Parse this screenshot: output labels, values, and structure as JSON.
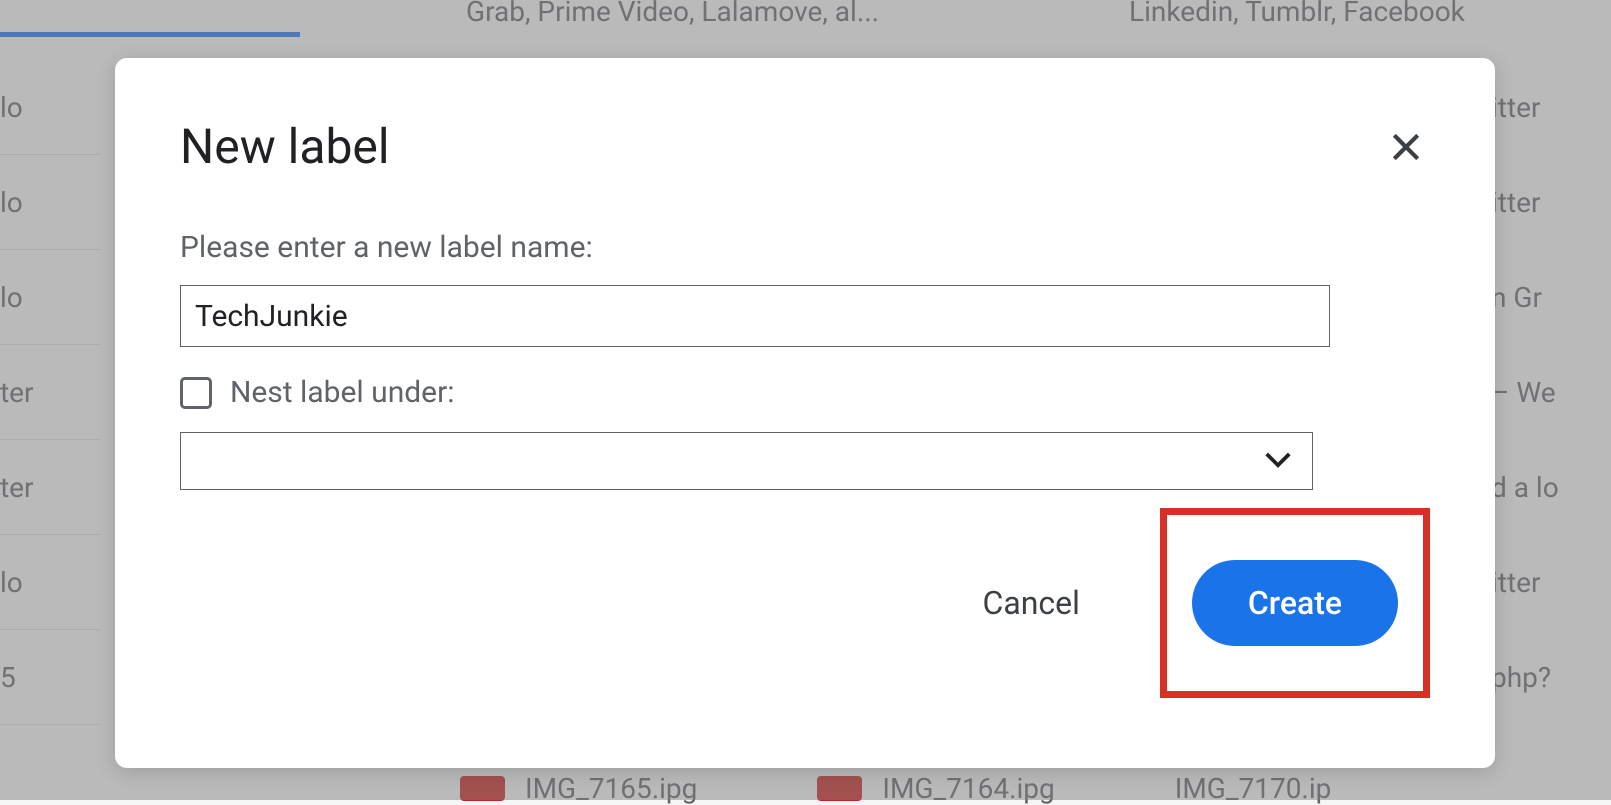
{
  "background": {
    "top_text_1": "Grab, Prime Video, Lalamove, al...",
    "top_text_2": "Linkedin, Tumblr, Facebook",
    "sidebar_items": [
      "lo",
      "lo",
      "lo",
      "ter",
      "ter",
      "lo",
      "5"
    ],
    "right_items": [
      "itter",
      "itter",
      "n Gr",
      " – We",
      "d a lo",
      "itter",
      "php?"
    ],
    "bottom_files": [
      "IMG_7165.ipg",
      "IMG_7164.ipg",
      "IMG_7170.ip"
    ]
  },
  "dialog": {
    "title": "New label",
    "name_label": "Please enter a new label name:",
    "name_value": "TechJunkie",
    "nest_label": "Nest label under:",
    "nest_checked": false,
    "nest_select_value": "",
    "cancel_label": "Cancel",
    "create_label": "Create"
  }
}
